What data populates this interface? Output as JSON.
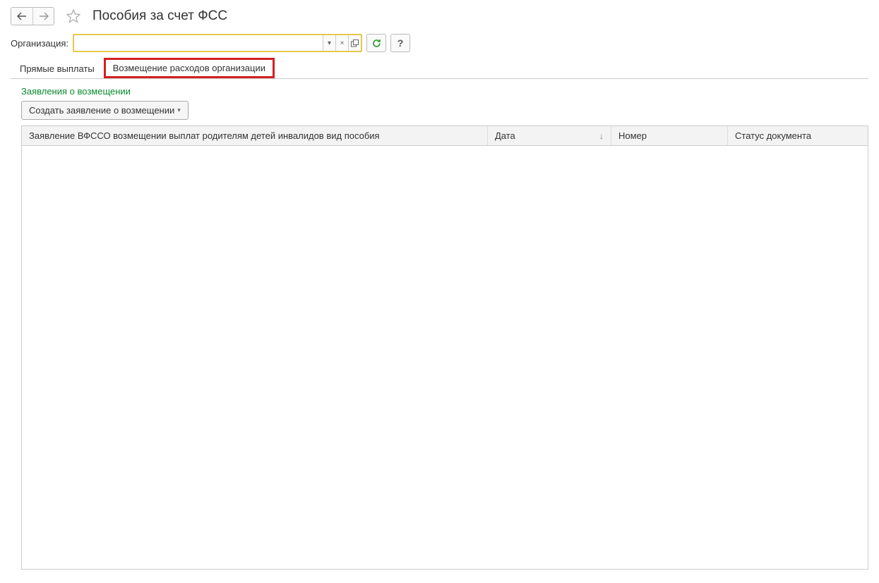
{
  "header": {
    "title": "Пособия за счет ФСС"
  },
  "filter": {
    "org_label": "Организация:",
    "org_value": ""
  },
  "tabs": [
    {
      "label": "Прямые выплаты",
      "active": false
    },
    {
      "label": "Возмещение расходов организации",
      "active": true
    }
  ],
  "section": {
    "title": "Заявления о возмещении",
    "create_button": "Создать заявление о возмещении"
  },
  "table": {
    "columns": {
      "application": "Заявление ВФССО возмещении выплат родителям детей инвалидов вид пособия",
      "date": "Дата",
      "number": "Номер",
      "status": "Статус документа"
    },
    "rows": []
  },
  "icons": {
    "help": "?"
  }
}
